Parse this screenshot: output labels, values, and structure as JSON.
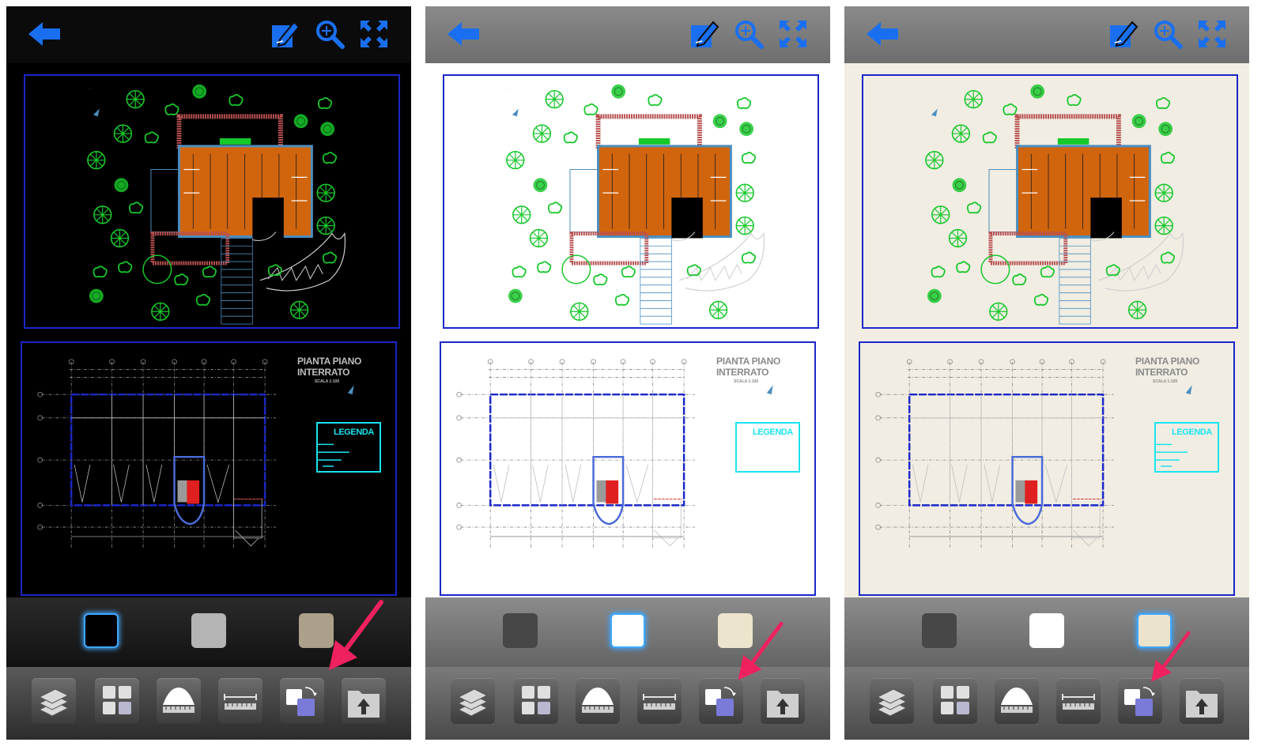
{
  "panels": [
    {
      "theme": "dark",
      "swatches": [
        {
          "color": "#000000",
          "selected": true
        },
        {
          "color": "#b4b4b4",
          "selected": false
        },
        {
          "color": "#aca08a",
          "selected": false
        }
      ]
    },
    {
      "theme": "light",
      "swatches": [
        {
          "color": "#474747",
          "selected": false
        },
        {
          "color": "#ffffff",
          "selected": true
        },
        {
          "color": "#ede4cd",
          "selected": false
        }
      ]
    },
    {
      "theme": "paper",
      "swatches": [
        {
          "color": "#474747",
          "selected": false
        },
        {
          "color": "#ffffff",
          "selected": false
        },
        {
          "color": "#ece3cc",
          "selected": true
        }
      ]
    }
  ],
  "header": {
    "back_icon": "back-arrow-icon",
    "edit_icon": "edit-icon",
    "zoom_icon": "zoom-icon",
    "fullscreen_icon": "fullscreen-icon"
  },
  "drawing": {
    "plan_title_line1": "PIANTA PIANO",
    "plan_title_line2": "INTERRATO",
    "plan_scale": "SCALA 1:100",
    "legend_title": "LEGENDA"
  },
  "toolbar": {
    "tools": [
      "layers-icon",
      "layouts-icon",
      "measure-area-icon",
      "measure-distance-icon",
      "background-color-icon",
      "export-icon"
    ]
  },
  "colors": {
    "accent_blue": "#1a6ff0",
    "roof_orange": "#d0650e",
    "tree_green": "#17c82a",
    "legend_cyan": "#19e4f0",
    "callout_pink": "#f0215f",
    "selected_glow": "#3ea7ff"
  }
}
